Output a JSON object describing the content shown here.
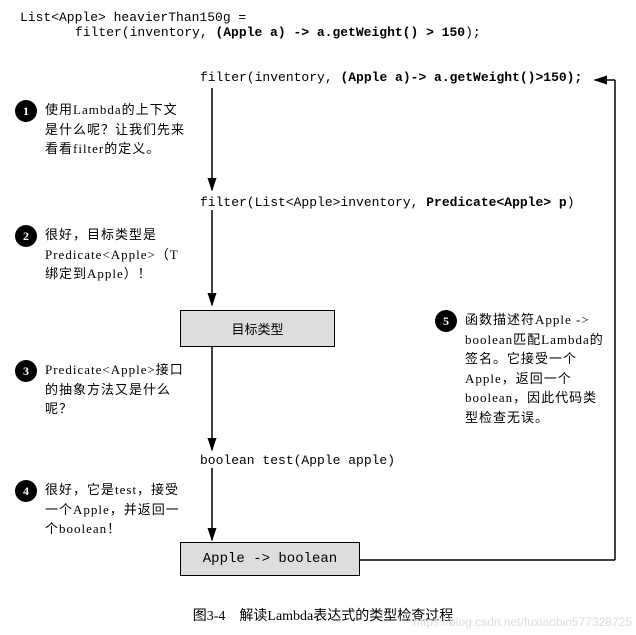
{
  "header": {
    "line1_a": "List<Apple> heavierThan150g =",
    "line2_a": "filter(inventory, ",
    "line2_b": "(Apple a) -> a.getWeight() > 150",
    "line2_c": ");"
  },
  "flow": {
    "top_a": "filter(inventory, ",
    "top_b": "(Apple a)-> a.getWeight()>150);",
    "sig_a": "filter(List<Apple>inventory, ",
    "sig_b": "Predicate<Apple> p",
    "sig_c": ")",
    "target_box": "目标类型",
    "test_method": "boolean test(Apple apple)",
    "result_box": "Apple -> boolean"
  },
  "steps": {
    "s1": "使用Lambda的上下文是什么呢？让我们先来看看filter的定义。",
    "s2": "很好，目标类型是Predicate<Apple>（T绑定到Apple）！",
    "s3": "Predicate<Apple>接口的抽象方法又是什么呢？",
    "s4": "很好，它是test，接受一个Apple，并返回一个boolean！",
    "s5": "函数描述符Apple -> boolean匹配Lambda的签名。它接受一个Apple，返回一个boolean，因此代码类型检查无误。"
  },
  "caption": "图3-4　解读Lambda表达式的类型检查过程",
  "watermark": "https://blog.csdn.net/fuxiaobin577328725"
}
